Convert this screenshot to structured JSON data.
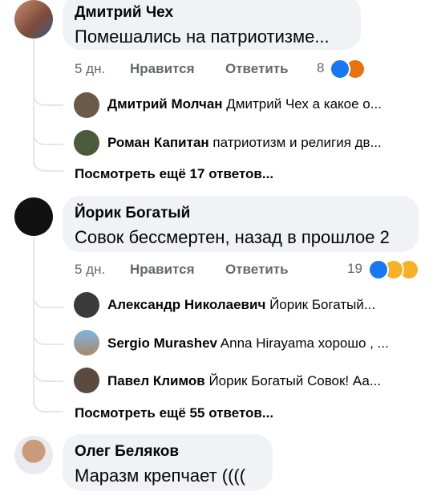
{
  "comments": [
    {
      "author": "Дмитрий Чех",
      "text": "Помешались на патриотизме...",
      "time": "5 дн.",
      "like": "Нравится",
      "reply": "Ответить",
      "reactions_count": "8",
      "replies": [
        {
          "name": "Дмитрий Молчан",
          "text": "Дмитрий Чех а какое о..."
        },
        {
          "name": "Роман Капитан",
          "text": "патриотизм и религия дв..."
        }
      ],
      "more": "Посмотреть ещё 17 ответов..."
    },
    {
      "author": "Йорик Богатый",
      "text": "Совок бессмертен, назад в прошлое 2",
      "time": "5 дн.",
      "like": "Нравится",
      "reply": "Ответить",
      "reactions_count": "19",
      "replies": [
        {
          "name": "Александр Николаевич",
          "text": "Йорик Богатый..."
        },
        {
          "name": "Sergio Murashev",
          "text": "Anna Hirayama хорошо , ..."
        },
        {
          "name": "Павел Климов",
          "text": "Йорик Богатый Совок! Аа..."
        }
      ],
      "more": "Посмотреть ещё 55 ответов..."
    },
    {
      "author": "Олег Беляков",
      "text": "Маразм крепчает (((("
    }
  ],
  "colors": {
    "like": "#1877f2",
    "angry": "#e9710f",
    "haha": "#f7b125",
    "sad": "#f7b125"
  }
}
